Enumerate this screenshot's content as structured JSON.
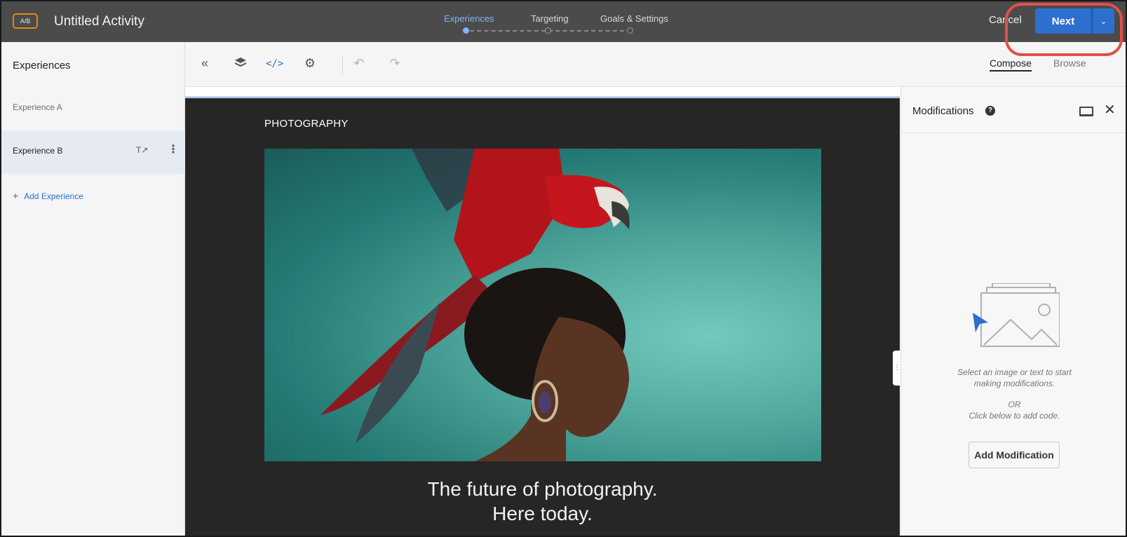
{
  "header": {
    "badge": "A/B",
    "activity_title": "Untitled Activity",
    "steps": [
      {
        "label": "Experiences",
        "active": true
      },
      {
        "label": "Targeting",
        "active": false
      },
      {
        "label": "Goals & Settings",
        "active": false
      }
    ],
    "cancel_label": "Cancel",
    "next_label": "Next",
    "next_caret_icon": "chevron-down-icon",
    "accent_color": "#2d6fcd",
    "highlight_color": "#e0514a"
  },
  "sidebar": {
    "title": "Experiences",
    "items": [
      {
        "label": "Experience A",
        "selected": false
      },
      {
        "label": "Experience B",
        "selected": true
      }
    ],
    "add_label": "Add Experience"
  },
  "toolbar": {
    "icons": [
      "collapse-left-icon",
      "layers-icon",
      "code-icon",
      "settings-icon",
      "undo-icon",
      "redo-icon"
    ],
    "tabs": [
      {
        "label": "Compose",
        "active": true
      },
      {
        "label": "Browse",
        "active": false
      }
    ]
  },
  "canvas": {
    "heading": "PHOTOGRAPHY",
    "tagline_line1": "The future of photography.",
    "tagline_line2": "Here today."
  },
  "modifications": {
    "title": "Modifications",
    "hint_line1": "Select an image or text to start",
    "hint_line2": "making modifications.",
    "or": "OR",
    "hint_line3": "Click below to add code.",
    "add_button": "Add Modification"
  }
}
